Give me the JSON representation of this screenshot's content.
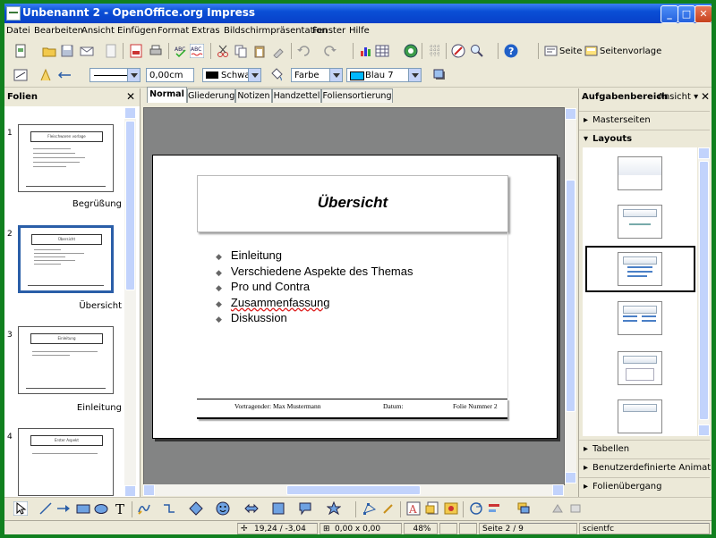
{
  "window": {
    "title": "Unbenannt 2 - OpenOffice.org Impress"
  },
  "menu": [
    "Datei",
    "Bearbeiten",
    "Ansicht",
    "Einfügen",
    "Format",
    "Extras",
    "Bildschirmpräsentation",
    "Fenster",
    "Hilfe"
  ],
  "toolbar": {
    "seite_label": "Seite",
    "seitenvorlage_label": "Seitenvorlage"
  },
  "format_toolbar": {
    "line_width": "0,00cm",
    "line_color": "Schwar",
    "area_style": "Farbe",
    "area_color": "Blau 7"
  },
  "slides_pane": {
    "title": "Folien",
    "thumbs": [
      {
        "num": "1",
        "title": "Fleischwaren vorlage",
        "label": "Begrüßung"
      },
      {
        "num": "2",
        "title": "Übersicht",
        "label": "Übersicht"
      },
      {
        "num": "3",
        "title": "Einleitung",
        "label": "Einleitung"
      },
      {
        "num": "4",
        "title": "Erster Aspekt",
        "label": ""
      }
    ]
  },
  "tabs": [
    "Normal",
    "Gliederung",
    "Notizen",
    "Handzettel",
    "Foliensortierung"
  ],
  "slide": {
    "title": "Übersicht",
    "bullets": [
      "Einleitung",
      "Verschiedene Aspekte des Themas",
      "Pro und Contra",
      "Zusammenfassung",
      "Diskussion"
    ],
    "footer_presenter": "Vortragender: Max Mustermann",
    "footer_date": "Datum:",
    "footer_slide": "Folie Nummer 2"
  },
  "task_pane": {
    "title": "Aufgabenbereich",
    "view": "Ansicht",
    "sections": {
      "master": "Masterseiten",
      "layouts": "Layouts",
      "tables": "Tabellen",
      "custom_animation": "Benutzerdefinierte Animation",
      "transition": "Folienübergang"
    }
  },
  "status": {
    "position": "19,24 / -3,04",
    "size": "0,00 x 0,00",
    "zoom": "48%",
    "page": "Seite 2 / 9",
    "master": "scientfc"
  }
}
